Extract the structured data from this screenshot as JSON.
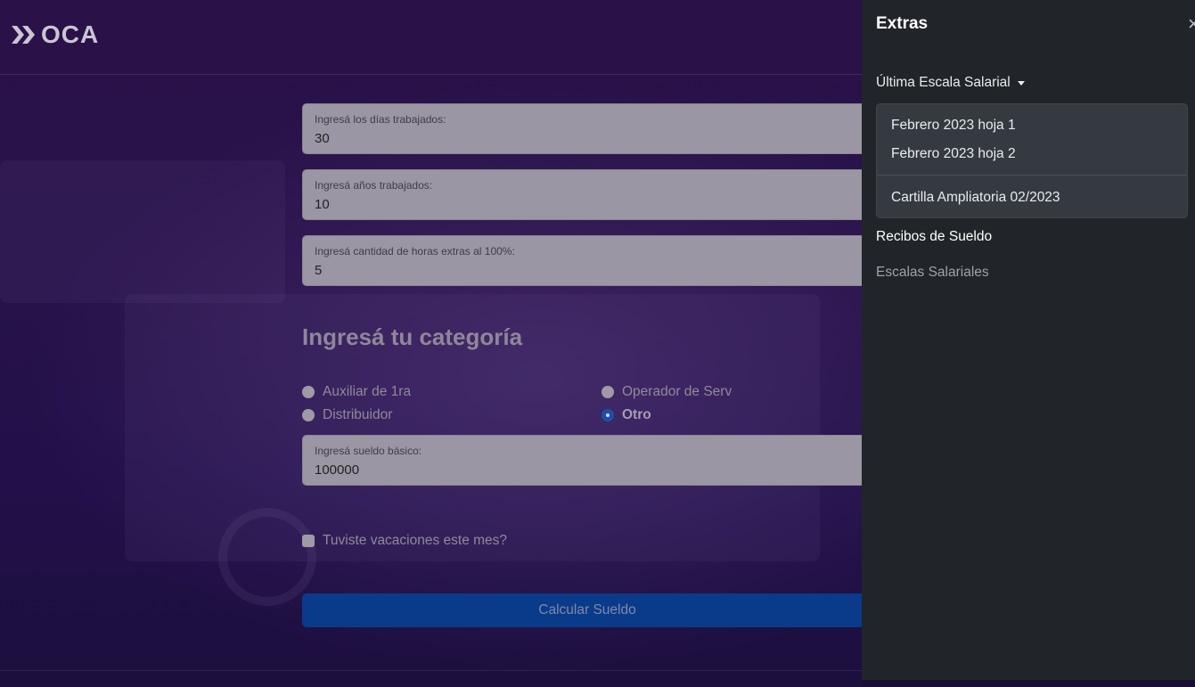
{
  "header": {
    "logo_text": "OCA"
  },
  "form": {
    "dias": {
      "label": "Ingresá los días trabajados:",
      "value": "30"
    },
    "anios": {
      "label": "Ingresá años trabajados:",
      "value": "10"
    },
    "horas": {
      "label": "Ingresá cantidad de horas extras al 100%:",
      "value": "5"
    },
    "category_title": "Ingresá tu categoría",
    "categories": [
      {
        "label": "Auxiliar de 1ra",
        "selected": false
      },
      {
        "label": "Operador de Serv",
        "selected": false
      },
      {
        "label": "Distribuidor",
        "selected": false
      },
      {
        "label": "Otro",
        "selected": true
      }
    ],
    "sueldo": {
      "label": "Ingresá sueldo básico:",
      "value": "100000"
    },
    "vacaciones_label": "Tuviste vacaciones este mes?",
    "calc_button": "Calcular Sueldo"
  },
  "panel": {
    "title": "Extras",
    "close_glyph": "×",
    "dropdown_label": "Última Escala Salarial",
    "dropdown_items": [
      "Febrero 2023 hoja 1",
      "Febrero 2023 hoja 2",
      "Cartilla Ampliatoria 02/2023"
    ],
    "nav_recibos": "Recibos de Sueldo",
    "nav_escalas": "Escalas Salariales"
  },
  "colors": {
    "panel_bg": "#212529",
    "dropdown_bg": "#343a40",
    "button_bg": "#0a3a8a",
    "radio_selected": "#1f4fa5"
  }
}
